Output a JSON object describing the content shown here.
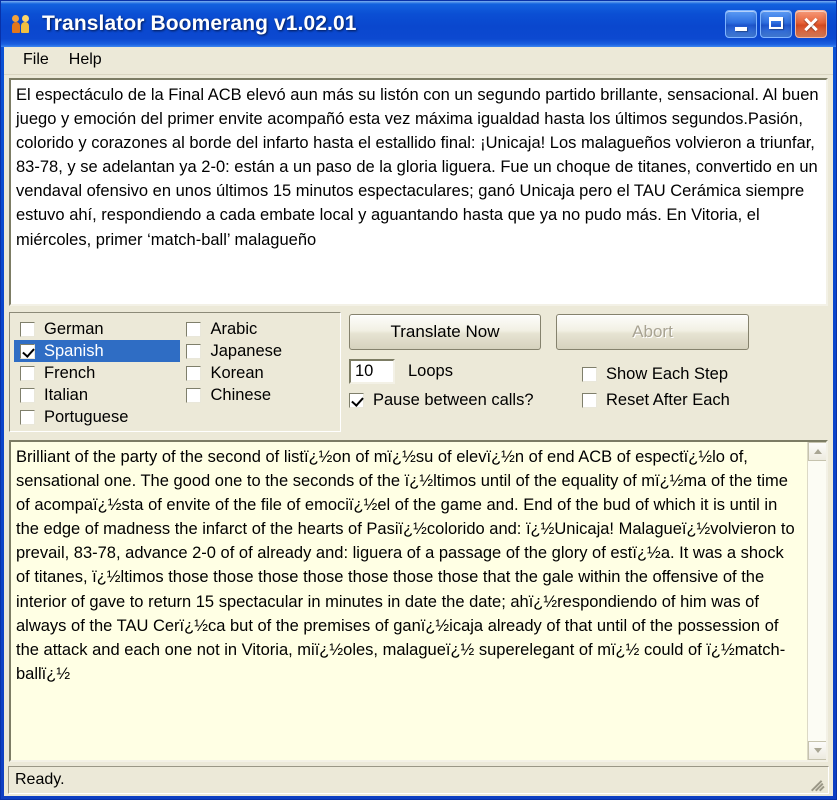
{
  "window": {
    "title": "Translator Boomerang v1.02.01",
    "icon": "people-icon",
    "caption_buttons": [
      {
        "name": "minimize",
        "glyph": "minimize-icon"
      },
      {
        "name": "maximize",
        "glyph": "maximize-icon"
      },
      {
        "name": "close",
        "glyph": "close-icon"
      }
    ],
    "accent_titlebar": "#0A4ACF",
    "accent_selection": "#2F6DC4",
    "face_color": "#ECE9D8",
    "output_bg": "#FFFFE4"
  },
  "menubar": {
    "items": [
      {
        "label": "File"
      },
      {
        "label": "Help"
      }
    ]
  },
  "source": {
    "text": "El espectáculo de la Final ACB elevó aun más su listón con un segundo partido brillante, sensacional. Al buen juego y emoción del primer envite acompañó esta vez máxima igualdad hasta los últimos segundos.Pasión, colorido y corazones al borde del infarto hasta el estallido final: ¡Unicaja! Los malagueños volvieron a triunfar, 83-78, y se adelantan ya 2-0: están a un paso de la gloria liguera. Fue un choque de titanes, convertido en un vendaval ofensivo en unos últimos 15 minutos espectaculares; ganó Unicaja pero el TAU Cerámica siempre estuvo ahí, respondiendo a cada embate local y aguantando hasta que ya no pudo más. En Vitoria, el miércoles, primer ‘match-ball’ malagueño"
  },
  "languages": {
    "column1": [
      {
        "label": "German",
        "checked": false,
        "selected": false
      },
      {
        "label": "Spanish",
        "checked": true,
        "selected": true
      },
      {
        "label": "French",
        "checked": false,
        "selected": false
      },
      {
        "label": "Italian",
        "checked": false,
        "selected": false
      },
      {
        "label": "Portuguese",
        "checked": false,
        "selected": false
      }
    ],
    "column2": [
      {
        "label": "Arabic",
        "checked": false,
        "selected": false
      },
      {
        "label": "Japanese",
        "checked": false,
        "selected": false
      },
      {
        "label": "Korean",
        "checked": false,
        "selected": false
      },
      {
        "label": "Chinese",
        "checked": false,
        "selected": false
      }
    ]
  },
  "controls": {
    "translate_label": "Translate Now",
    "abort_label": "Abort",
    "abort_enabled": false,
    "loops_value": "10",
    "loops_label": "Loops",
    "pause_label": "Pause between calls?",
    "pause_checked": true,
    "show_each_step_label": "Show Each Step",
    "show_each_step_checked": false,
    "reset_after_each_label": "Reset After Each",
    "reset_after_each_checked": false
  },
  "output": {
    "text": "Brilliant of the party of the second of listï¿½on of mï¿½su of elevï¿½n of end ACB of espectï¿½lo of, sensational one. The good one to the seconds of the ï¿½ltimos until of the equality of mï¿½ma of the time of acompaï¿½sta of envite of the file of emociï¿½el of the game and. End of the bud of which it is until in the edge of madness the infarct of the hearts of Pasiï¿½colorido and: ï¿½Unicaja! Malagueï¿½volvieron to prevail, 83-78, advance 2-0 of of already and: liguera of a passage of the glory of estï¿½a. It was a shock of titanes, ï¿½ltimos those those those those those those those that the gale within the offensive of the interior of gave to return 15 spectacular in minutes in date the date; ahï¿½respondiendo of him was of always of the TAU Cerï¿½ca but of the premises of ganï¿½icaja already of that until of the possession of the attack and each one not in Vitoria, miï¿½oles, malagueï¿½ superelegant of mï¿½ could of ï¿½match-ballï¿½",
    "scrollbar": {
      "up": "scroll-up-icon",
      "down": "scroll-down-icon"
    }
  },
  "statusbar": {
    "text": "Ready."
  }
}
